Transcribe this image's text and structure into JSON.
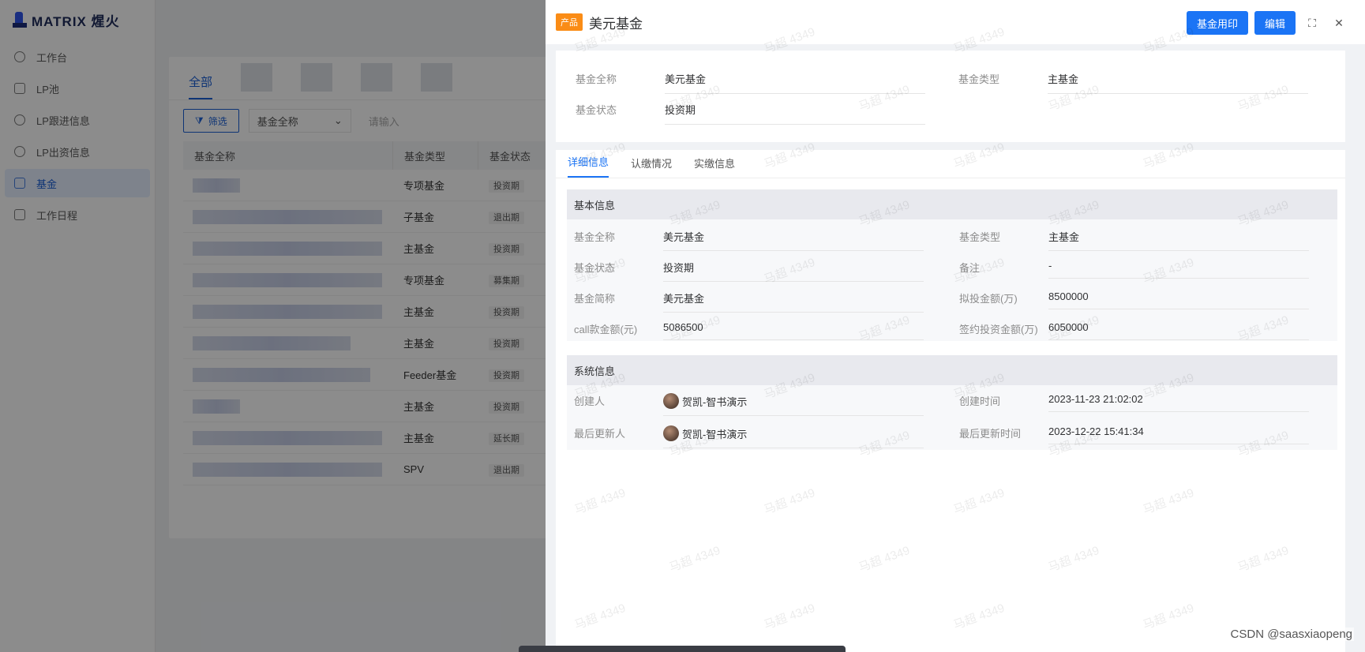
{
  "app": {
    "logo_text": "MATRIX 煋火",
    "nav": [
      {
        "label": "工作台",
        "icon": "dashboard-icon"
      },
      {
        "label": "LP池",
        "icon": "lp-pool-icon"
      },
      {
        "label": "LP跟进信息",
        "icon": "follow-up-icon"
      },
      {
        "label": "LP出资信息",
        "icon": "star-icon"
      },
      {
        "label": "基金",
        "icon": "bag-icon",
        "active": true
      },
      {
        "label": "工作日程",
        "icon": "calendar-icon"
      }
    ]
  },
  "list": {
    "tab_all": "全部",
    "filter_label": "筛选",
    "filter_field": "基金全称",
    "search_placeholder": "请输入",
    "columns": [
      "基金全称",
      "基金类型",
      "基金状态"
    ],
    "rows": [
      {
        "type": "专项基金",
        "status": "投资期"
      },
      {
        "type": "子基金",
        "status": "退出期"
      },
      {
        "type": "主基金",
        "status": "投资期"
      },
      {
        "type": "专项基金",
        "status": "募集期"
      },
      {
        "type": "主基金",
        "status": "投资期"
      },
      {
        "type": "主基金",
        "status": "投资期"
      },
      {
        "type": "Feeder基金",
        "status": "投资期"
      },
      {
        "type": "主基金",
        "status": "投资期"
      },
      {
        "type": "主基金",
        "status": "延长期"
      },
      {
        "type": "SPV",
        "status": "退出期"
      }
    ]
  },
  "drawer": {
    "badge": "产品",
    "title": "美元基金",
    "btn_print": "基金用印",
    "btn_edit": "编辑",
    "summary": {
      "name_label": "基金全称",
      "name": "美元基金",
      "type_label": "基金类型",
      "type": "主基金",
      "status_label": "基金状态",
      "status": "投资期"
    },
    "tabs": [
      "详细信息",
      "认缴情况",
      "实缴信息"
    ],
    "basic": {
      "title": "基本信息",
      "fields": [
        {
          "k": "基金全称",
          "v": "美元基金"
        },
        {
          "k": "基金类型",
          "v": "主基金"
        },
        {
          "k": "基金状态",
          "v": "投资期"
        },
        {
          "k": "备注",
          "v": "-"
        },
        {
          "k": "基金简称",
          "v": "美元基金"
        },
        {
          "k": "拟投金额(万)",
          "v": "8500000"
        },
        {
          "k": "call款金额(元)",
          "v": "5086500"
        },
        {
          "k": "签约投资金额(万)",
          "v": "6050000"
        }
      ]
    },
    "system": {
      "title": "系统信息",
      "fields": [
        {
          "k": "创建人",
          "v": "贺凯-智书演示"
        },
        {
          "k": "创建时间",
          "v": "2023-11-23 21:02:02"
        },
        {
          "k": "最后更新人",
          "v": "贺凯-智书演示"
        },
        {
          "k": "最后更新时间",
          "v": "2023-12-22 15:41:34"
        }
      ]
    }
  },
  "watermark": "马超 4349",
  "credit": "CSDN @saasxiaopeng"
}
